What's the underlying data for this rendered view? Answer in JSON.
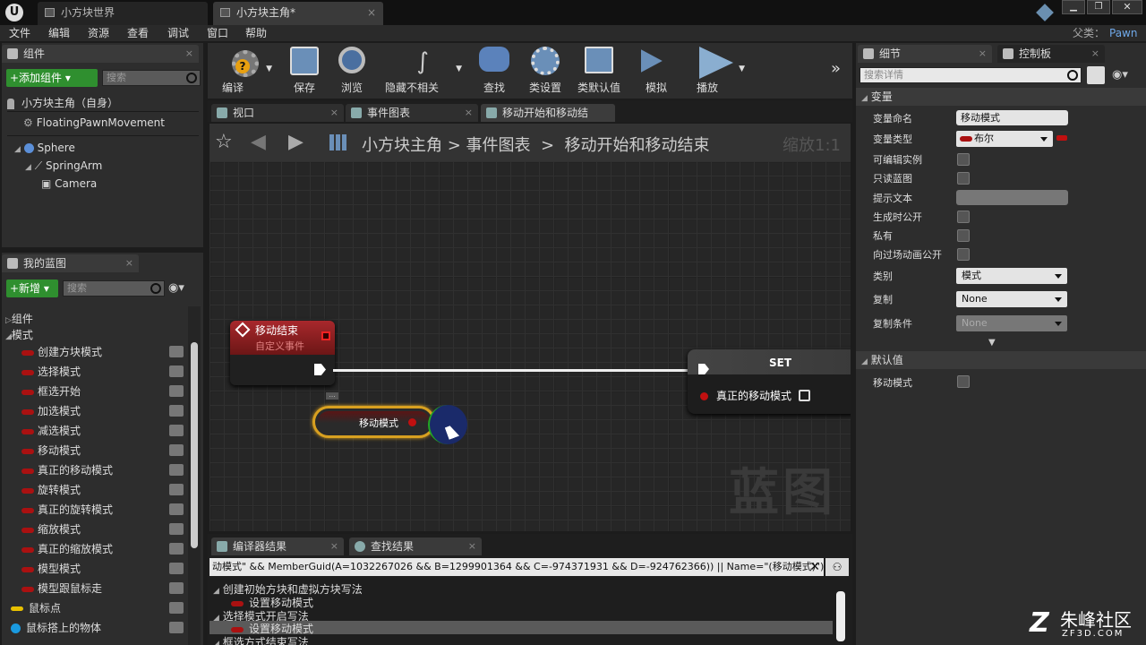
{
  "window": {
    "tabs": [
      {
        "label": "小方块世界"
      },
      {
        "label": "小方块主角*"
      }
    ],
    "parent_class_label": "父类：",
    "parent_class_value": "Pawn"
  },
  "menu": [
    "文件",
    "编辑",
    "资源",
    "查看",
    "调试",
    "窗口",
    "帮助"
  ],
  "components_panel": {
    "tab": "组件",
    "add_button": "+添加组件",
    "search_placeholder": "搜索",
    "root": "小方块主角（自身）",
    "items": [
      "FloatingPawnMovement",
      "Sphere",
      "SpringArm",
      "Camera"
    ]
  },
  "my_blueprint": {
    "tab": "我的蓝图",
    "new_button": "+新增",
    "search_placeholder": "搜索",
    "sections": [
      "组件",
      "模式"
    ],
    "variables": [
      "创建方块模式",
      "选择模式",
      "框选开始",
      "加选模式",
      "减选模式",
      "移动模式",
      "真正的移动模式",
      "旋转模式",
      "真正的旋转模式",
      "缩放模式",
      "真正的缩放模式",
      "模型模式",
      "模型跟鼠标走",
      "鼠标点",
      "鼠标搭上的物体"
    ]
  },
  "toolbar": [
    "编译",
    "保存",
    "浏览",
    "隐藏不相关",
    "查找",
    "类设置",
    "类默认值",
    "模拟",
    "播放"
  ],
  "editor_tabs": [
    "视口",
    "事件图表",
    "移动开始和移动结"
  ],
  "breadcrumb": {
    "root": "小方块主角",
    "graph": "事件图表",
    "sub": "移动开始和移动结束",
    "zoom": "缩放1:1"
  },
  "graph": {
    "event_node": {
      "title": "移动结束",
      "subtitle": "自定义事件"
    },
    "var_node": {
      "label": "移动模式"
    },
    "set_node": {
      "title": "SET",
      "pin": "真正的移动模式"
    },
    "watermark": "蓝图"
  },
  "bottom": {
    "tabs": [
      "编译器结果",
      "查找结果"
    ],
    "query": "动模式\" && MemberGuid(A=1032267026 && B=1299901364 && C=-974371931 && D=-924762366)) || Name=\"(移动模式)\")",
    "results": [
      "创建初始方块和虚拟方块写法",
      "设置移动模式",
      "选择模式开启写法",
      "设置移动模式",
      "框选方式结束写法"
    ]
  },
  "details": {
    "tabs": [
      "细节",
      "控制板"
    ],
    "search_placeholder": "搜索详情",
    "section_var": "变量",
    "props": {
      "name_label": "变量命名",
      "name_value": "移动模式",
      "type_label": "变量类型",
      "type_value": "布尔",
      "editable": "可编辑实例",
      "readonly": "只读蓝图",
      "tooltip": "提示文本",
      "expose": "生成时公开",
      "private": "私有",
      "cinematic": "向过场动画公开",
      "category_label": "类别",
      "category_value": "模式",
      "replication_label": "复制",
      "replication_value": "None",
      "repcond_label": "复制条件",
      "repcond_value": "None"
    },
    "section_default": "默认值",
    "default_label": "移动模式"
  },
  "watermark_logo": {
    "text": "朱峰社区",
    "url": "ZF3D.COM"
  },
  "colors": {
    "bool_red": "#a50d0d",
    "exec_white": "#ffffff",
    "accent_green": "#2f8f2f",
    "selection_orange": "#d8a020"
  }
}
